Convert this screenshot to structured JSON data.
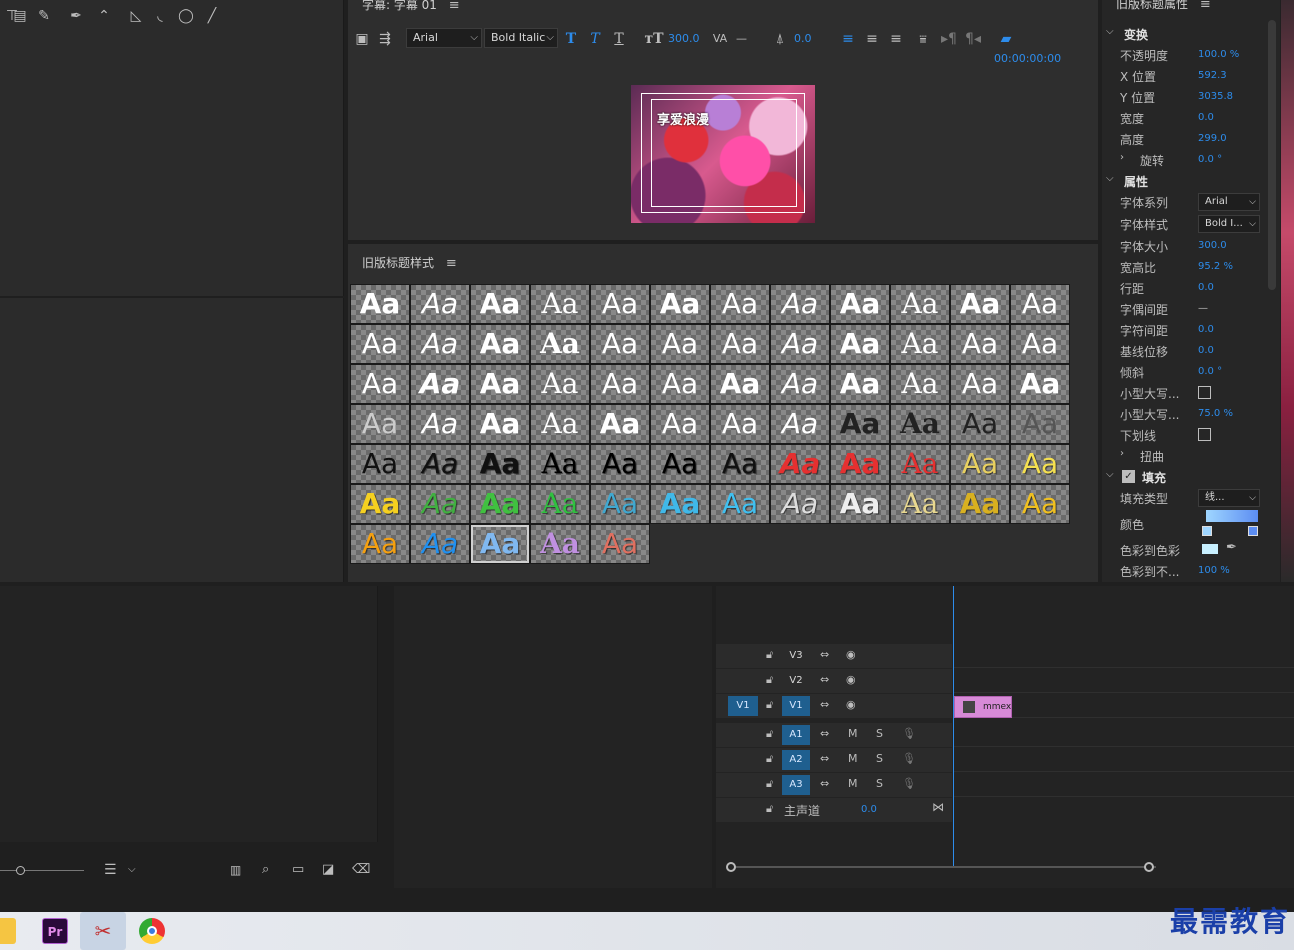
{
  "titler": {
    "title": "字幕: 字幕 01",
    "font_family": "Arial",
    "font_style": "Bold Italic",
    "font_size": "300.0",
    "tracking": "—",
    "baseline": "0.0",
    "timecode": "00:00:00:00",
    "preview_text": "享爱浪漫"
  },
  "styles": {
    "title": "旧版标题样式",
    "swatches": [
      {
        "color": "#ffffff"
      },
      {
        "color": "#ffffff"
      },
      {
        "color": "#ffffff"
      },
      {
        "color": "#ffffff"
      },
      {
        "color": "#ffffff"
      },
      {
        "color": "#ffffff"
      },
      {
        "color": "#ffffff"
      },
      {
        "color": "#ffffff"
      },
      {
        "color": "#ffffff"
      },
      {
        "color": "#ffffff"
      },
      {
        "color": "#ffffff"
      },
      {
        "color": "#ffffff"
      },
      {
        "color": "#ffffff"
      },
      {
        "color": "#ffffff"
      },
      {
        "color": "#ffffff"
      },
      {
        "color": "#ffffff"
      },
      {
        "color": "#ffffff"
      },
      {
        "color": "#ffffff"
      },
      {
        "color": "#ffffff"
      },
      {
        "color": "#ffffff"
      },
      {
        "color": "#ffffff"
      },
      {
        "color": "#ffffff"
      },
      {
        "color": "#ffffff"
      },
      {
        "color": "#ffffff"
      },
      {
        "color": "#ffffff"
      },
      {
        "color": "#ffffff"
      },
      {
        "color": "#ffffff"
      },
      {
        "color": "#ffffff"
      },
      {
        "color": "#ffffff"
      },
      {
        "color": "#ffffff"
      },
      {
        "color": "#ffffff"
      },
      {
        "color": "#ffffff"
      },
      {
        "color": "#ffffff"
      },
      {
        "color": "#ffffff"
      },
      {
        "color": "#ffffff"
      },
      {
        "color": "#ffffff"
      },
      {
        "color": "#cccccc"
      },
      {
        "color": "#ffffff"
      },
      {
        "color": "#ffffff"
      },
      {
        "color": "#ffffff"
      },
      {
        "color": "#ffffff"
      },
      {
        "color": "#ffffff"
      },
      {
        "color": "#ffffff"
      },
      {
        "color": "#ffffff"
      },
      {
        "color": "#222222"
      },
      {
        "color": "#222222"
      },
      {
        "color": "#222222"
      },
      {
        "color": "#555555"
      },
      {
        "color": "#111111"
      },
      {
        "color": "#111111"
      },
      {
        "color": "#111111"
      },
      {
        "color": "#000000"
      },
      {
        "color": "#000000"
      },
      {
        "color": "#000000"
      },
      {
        "color": "#111111"
      },
      {
        "color": "#e53030"
      },
      {
        "color": "#e53030"
      },
      {
        "color": "#e53030"
      },
      {
        "color": "#e8d060"
      },
      {
        "color": "#f5e050"
      },
      {
        "color": "#f5d020"
      },
      {
        "color": "#40b040"
      },
      {
        "color": "#40c040"
      },
      {
        "color": "#30c040"
      },
      {
        "color": "#40a8d0"
      },
      {
        "color": "#40b8e8"
      },
      {
        "color": "#40c0f0"
      },
      {
        "color": "#dddddd"
      },
      {
        "color": "#eeeeee"
      },
      {
        "color": "#e8d890"
      },
      {
        "color": "#d8b020"
      },
      {
        "color": "#f0c020"
      },
      {
        "color": "#f5a010"
      },
      {
        "color": "#2090f0"
      },
      {
        "color": "#80b8f0"
      },
      {
        "color": "#c090e0"
      },
      {
        "color": "#e07060"
      }
    ],
    "selected_index": 74
  },
  "props": {
    "title": "旧版标题属性",
    "sections": {
      "transform": "变换",
      "properties": "属性",
      "fill": "填充"
    },
    "rows": {
      "opacity": {
        "label": "不透明度",
        "value": "100.0 %"
      },
      "x": {
        "label": "X 位置",
        "value": "592.3"
      },
      "y": {
        "label": "Y 位置",
        "value": "3035.8"
      },
      "width": {
        "label": "宽度",
        "value": "0.0"
      },
      "height": {
        "label": "高度",
        "value": "299.0"
      },
      "rotation": {
        "label": "旋转",
        "value": "0.0 °"
      },
      "font_family": {
        "label": "字体系列",
        "value": "Arial"
      },
      "font_style": {
        "label": "字体样式",
        "value": "Bold I..."
      },
      "font_size": {
        "label": "字体大小",
        "value": "300.0"
      },
      "aspect": {
        "label": "宽高比",
        "value": "95.2 %"
      },
      "leading": {
        "label": "行距",
        "value": "0.0"
      },
      "kerning": {
        "label": "字偶间距",
        "value": "—"
      },
      "tracking": {
        "label": "字符间距",
        "value": "0.0"
      },
      "baseline": {
        "label": "基线位移",
        "value": "0.0"
      },
      "slant": {
        "label": "倾斜",
        "value": "0.0 °"
      },
      "small_caps": {
        "label": "小型大写..."
      },
      "small_caps_size": {
        "label": "小型大写...",
        "value": "75.0 %"
      },
      "underline": {
        "label": "下划线"
      },
      "distort": {
        "label": "扭曲"
      },
      "fill_type": {
        "label": "填充类型",
        "value": "线..."
      },
      "color": {
        "label": "颜色"
      },
      "color_stop": {
        "label": "色彩到色彩"
      },
      "color_opacity": {
        "label": "色彩到不...",
        "value": "100 %"
      }
    }
  },
  "timeline": {
    "tracks": [
      {
        "name": "V3",
        "kind": "video"
      },
      {
        "name": "V2",
        "kind": "video"
      },
      {
        "name": "V1",
        "kind": "video",
        "source": "V1"
      },
      {
        "name": "A1",
        "kind": "audio"
      },
      {
        "name": "A2",
        "kind": "audio"
      },
      {
        "name": "A3",
        "kind": "audio"
      }
    ],
    "master": {
      "label": "主声道",
      "value": "0.0"
    },
    "clip_name": "mmex",
    "mute": "M",
    "solo": "S"
  },
  "taskbar": {
    "premiere_label": "Pr"
  },
  "watermark": "最需教育"
}
